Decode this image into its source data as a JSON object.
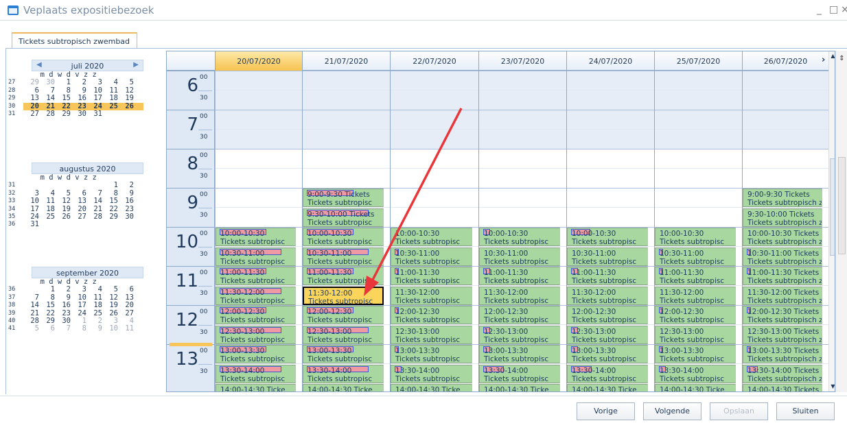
{
  "window": {
    "title": "Veplaats expositiebezoek",
    "minimize": "_",
    "maximize": "□",
    "close": "×"
  },
  "tabs": [
    {
      "label": "Tickets subtropisch zwembad"
    }
  ],
  "mini_calendars": [
    {
      "title": "juli 2020",
      "prev": "◀",
      "next": "▶",
      "dows": "m d w d v z z",
      "weeks": [
        {
          "wk": "27",
          "days": [
            [
              "29",
              "dim"
            ],
            [
              "30",
              "dim"
            ],
            [
              "1",
              ""
            ],
            [
              "2",
              ""
            ],
            [
              "3",
              ""
            ],
            [
              "4",
              ""
            ],
            [
              "5",
              ""
            ]
          ]
        },
        {
          "wk": "28",
          "days": [
            [
              "6",
              ""
            ],
            [
              "7",
              ""
            ],
            [
              "8",
              ""
            ],
            [
              "9",
              ""
            ],
            [
              "10",
              ""
            ],
            [
              "11",
              ""
            ],
            [
              "12",
              ""
            ]
          ]
        },
        {
          "wk": "29",
          "days": [
            [
              "13",
              ""
            ],
            [
              "14",
              ""
            ],
            [
              "15",
              ""
            ],
            [
              "16",
              ""
            ],
            [
              "17",
              ""
            ],
            [
              "18",
              ""
            ],
            [
              "19",
              ""
            ]
          ]
        },
        {
          "wk": "30",
          "days": [
            [
              "20",
              "sel"
            ],
            [
              "21",
              "sel"
            ],
            [
              "22",
              "sel"
            ],
            [
              "23",
              "sel"
            ],
            [
              "24",
              "sel"
            ],
            [
              "25",
              "sel"
            ],
            [
              "26",
              "sel"
            ]
          ]
        },
        {
          "wk": "31",
          "days": [
            [
              "27",
              ""
            ],
            [
              "28",
              ""
            ],
            [
              "29",
              ""
            ],
            [
              "30",
              ""
            ],
            [
              "31",
              ""
            ]
          ]
        }
      ]
    },
    {
      "title": "augustus 2020",
      "dows": "m d w d v z z",
      "weeks": [
        {
          "wk": "31",
          "days": [
            [
              "",
              ""
            ],
            [
              "",
              ""
            ],
            [
              "",
              ""
            ],
            [
              "",
              ""
            ],
            [
              "",
              ""
            ],
            [
              "1",
              ""
            ],
            [
              "2",
              ""
            ]
          ]
        },
        {
          "wk": "32",
          "days": [
            [
              "3",
              ""
            ],
            [
              "4",
              ""
            ],
            [
              "5",
              ""
            ],
            [
              "6",
              ""
            ],
            [
              "7",
              ""
            ],
            [
              "8",
              ""
            ],
            [
              "9",
              ""
            ]
          ]
        },
        {
          "wk": "33",
          "days": [
            [
              "10",
              ""
            ],
            [
              "11",
              ""
            ],
            [
              "12",
              ""
            ],
            [
              "13",
              ""
            ],
            [
              "14",
              ""
            ],
            [
              "15",
              ""
            ],
            [
              "16",
              ""
            ]
          ]
        },
        {
          "wk": "34",
          "days": [
            [
              "17",
              ""
            ],
            [
              "18",
              ""
            ],
            [
              "19",
              ""
            ],
            [
              "20",
              ""
            ],
            [
              "21",
              ""
            ],
            [
              "22",
              ""
            ],
            [
              "23",
              ""
            ]
          ]
        },
        {
          "wk": "35",
          "days": [
            [
              "24",
              ""
            ],
            [
              "25",
              ""
            ],
            [
              "26",
              ""
            ],
            [
              "27",
              ""
            ],
            [
              "28",
              ""
            ],
            [
              "29",
              ""
            ],
            [
              "30",
              ""
            ]
          ]
        },
        {
          "wk": "36",
          "days": [
            [
              "31",
              ""
            ]
          ]
        }
      ]
    },
    {
      "title": "september 2020",
      "dows": "m d w d v z z",
      "weeks": [
        {
          "wk": "36",
          "days": [
            [
              "",
              ""
            ],
            [
              "1",
              ""
            ],
            [
              "2",
              ""
            ],
            [
              "3",
              ""
            ],
            [
              "4",
              ""
            ],
            [
              "5",
              ""
            ],
            [
              "6",
              ""
            ]
          ]
        },
        {
          "wk": "37",
          "days": [
            [
              "7",
              ""
            ],
            [
              "8",
              ""
            ],
            [
              "9",
              ""
            ],
            [
              "10",
              ""
            ],
            [
              "11",
              ""
            ],
            [
              "12",
              ""
            ],
            [
              "13",
              ""
            ]
          ]
        },
        {
          "wk": "38",
          "days": [
            [
              "14",
              ""
            ],
            [
              "15",
              ""
            ],
            [
              "16",
              ""
            ],
            [
              "17",
              ""
            ],
            [
              "18",
              ""
            ],
            [
              "19",
              ""
            ],
            [
              "20",
              ""
            ]
          ]
        },
        {
          "wk": "39",
          "days": [
            [
              "21",
              ""
            ],
            [
              "22",
              ""
            ],
            [
              "23",
              ""
            ],
            [
              "24",
              ""
            ],
            [
              "25",
              ""
            ],
            [
              "26",
              ""
            ],
            [
              "27",
              ""
            ]
          ]
        },
        {
          "wk": "40",
          "days": [
            [
              "28",
              ""
            ],
            [
              "29",
              ""
            ],
            [
              "30",
              ""
            ],
            [
              "1",
              "dim"
            ],
            [
              "2",
              "dim"
            ],
            [
              "3",
              "dim"
            ],
            [
              "4",
              "dim"
            ]
          ]
        },
        {
          "wk": "41",
          "days": [
            [
              "5",
              "dim"
            ],
            [
              "6",
              "dim"
            ],
            [
              "7",
              "dim"
            ],
            [
              "8",
              "dim"
            ],
            [
              "9",
              "dim"
            ],
            [
              "10",
              "dim"
            ],
            [
              "11",
              "dim"
            ]
          ]
        }
      ]
    }
  ],
  "scheduler": {
    "prev_arrow": "‹",
    "next_arrow": "›",
    "dates": [
      "20/07/2020",
      "21/07/2020",
      "22/07/2020",
      "23/07/2020",
      "24/07/2020",
      "25/07/2020",
      "26/07/2020"
    ],
    "selected_date_index": 0,
    "hours": [
      "6",
      "7",
      "8",
      "9",
      "10",
      "11",
      "12",
      "13"
    ],
    "min00": "00",
    "min30": "30",
    "ticket_text": "Tickets subtropisc",
    "ticket_text_long": "Tickets subtropisch zwemb",
    "slots": [
      "9:00-9:30",
      "9:30-10:00",
      "10:00-10:30",
      "10:30-11:00",
      "11:00-11:30",
      "11:30-12:00",
      "12:00-12:30",
      "12:30-13:00",
      "13:00-13:30",
      "13:30-14:00",
      "14:00-14:30"
    ],
    "last_row_text": "14:00-14:30 Ticke",
    "last_row_text_long": "14:00-14:30 Tickets",
    "selected_slot": {
      "day": 1,
      "time": "11:30-12:00"
    }
  },
  "buttons": {
    "previous": "Vorige",
    "next": "Volgende",
    "save": "Opslaan",
    "close": "Sluiten"
  },
  "colors": {
    "accent_selection": "#f8c55a",
    "appointment": "#a8d8a0",
    "header": "#dfe9f5",
    "arrow": "#e8363a"
  }
}
